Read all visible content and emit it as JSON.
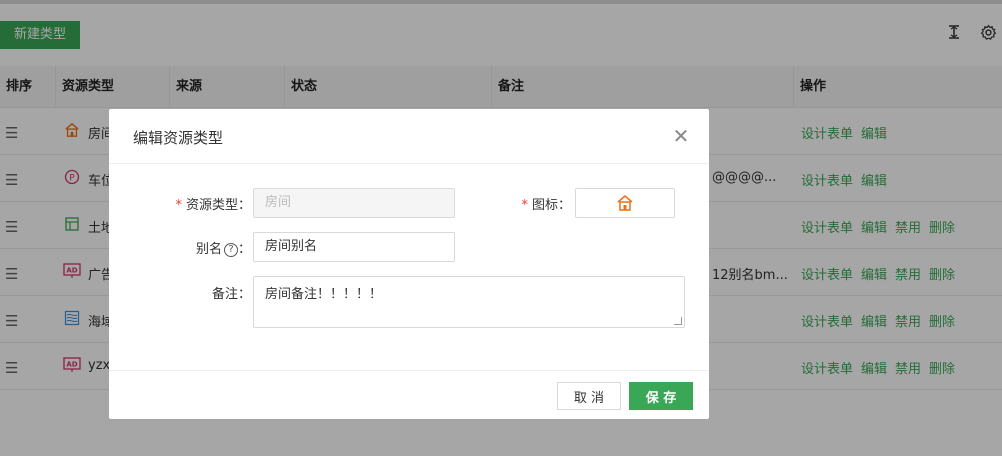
{
  "toolbar": {
    "new_type_label": "新建类型",
    "icons": [
      "column-height-icon",
      "gear-icon"
    ]
  },
  "table": {
    "columns": [
      "排序",
      "资源类型",
      "来源",
      "状态",
      "备注",
      "操作"
    ],
    "rows": [
      {
        "icon": "house-icon",
        "icon_color": "#e8711a",
        "name": "房间",
        "note": "",
        "ops": [
          "设计表单",
          "编辑"
        ]
      },
      {
        "icon": "parking-icon",
        "icon_color": "#d6336c",
        "name": "车位",
        "note": "@@@@...",
        "ops": [
          "设计表单",
          "编辑"
        ]
      },
      {
        "icon": "land-icon",
        "icon_color": "#3aa757",
        "name": "土地",
        "note": "",
        "ops": [
          "设计表单",
          "编辑",
          "禁用",
          "删除"
        ]
      },
      {
        "icon": "ad-icon",
        "icon_color": "#d6336c",
        "name": "广告",
        "note": "12别名bm...",
        "ops": [
          "设计表单",
          "编辑",
          "禁用",
          "删除"
        ]
      },
      {
        "icon": "sea-icon",
        "icon_color": "#3b8fd9",
        "name": "海域",
        "note": "",
        "ops": [
          "设计表单",
          "编辑",
          "禁用",
          "删除"
        ]
      },
      {
        "icon": "ad-icon",
        "icon_color": "#d6336c",
        "name": "yzx",
        "note": "",
        "ops": [
          "设计表单",
          "编辑",
          "禁用",
          "删除"
        ]
      }
    ]
  },
  "modal": {
    "title": "编辑资源类型",
    "fields": {
      "type_label": "资源类型：",
      "type_value": "房间",
      "icon_label": "图标：",
      "icon_value": "house-icon",
      "alias_label": "别名",
      "alias_value": "房间别名",
      "note_label": "备注：",
      "note_value": "房间备注！！！！！"
    },
    "cancel_label": "取 消",
    "save_label": "保 存"
  },
  "colors": {
    "accent": "#3aa757",
    "required": "#e53935",
    "house_icon": "#e8711a"
  }
}
